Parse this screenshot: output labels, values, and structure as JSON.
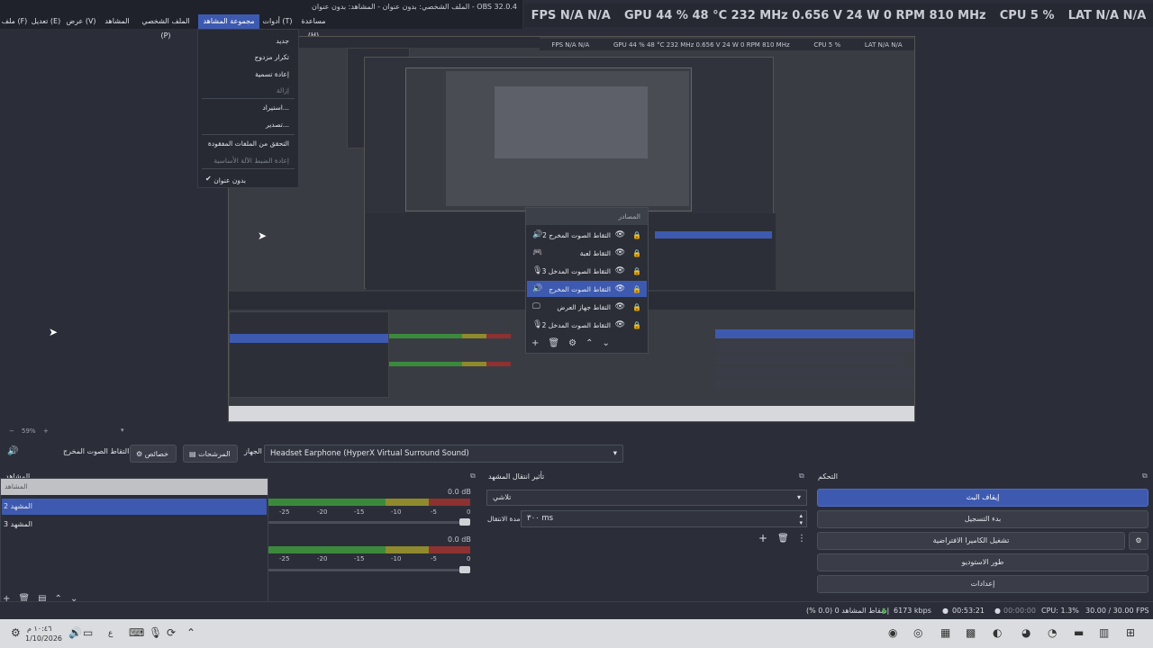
{
  "window": {
    "title": "OBS 32.0.4 - الملف الشخصي: بدون عنوان - المشاهد: بدون عنوان"
  },
  "menu": [
    {
      "label": "ملف (F)"
    },
    {
      "label": "تعديل (E)"
    },
    {
      "label": "عرض (V)"
    },
    {
      "label": "المشاهد"
    },
    {
      "label": "الملف الشخصي (P)"
    },
    {
      "label": "مجموعة المشاهد (S)"
    },
    {
      "label": "أدوات (T)"
    },
    {
      "label": "مساعدة (H)"
    }
  ],
  "stats_overlay": {
    "fps": "FPS  N/A  N/A",
    "gpu": "GPU  44 %  48 °C  232 MHz  0.656 V  24 W  0 RPM  810 MHz",
    "cpu": "CPU  5 %",
    "lat": "LAT  N/A  N/A"
  },
  "dropdown": {
    "items": [
      {
        "label": "جديد",
        "disabled": false
      },
      {
        "label": "تكرار مزدوج",
        "disabled": false
      },
      {
        "label": "إعادة تسمية",
        "disabled": false
      },
      {
        "label": "إزالة",
        "disabled": true
      },
      {
        "label": "استيراد...",
        "disabled": false
      },
      {
        "label": "تصدير...",
        "disabled": false
      },
      {
        "label": "التحقق من الملفات المفقودة",
        "disabled": false
      },
      {
        "label": "إعادة الضبط الآلة الأساسية",
        "disabled": true
      },
      {
        "label": "بدون عنوان",
        "disabled": false,
        "checked": true
      }
    ]
  },
  "sources": {
    "header": "المصادر",
    "items": [
      {
        "label": "التقاط الصوت المخرج 2",
        "icon": "speaker-icon"
      },
      {
        "label": "التقاط لعبة",
        "icon": "gamepad-icon"
      },
      {
        "label": "التقاط الصوت المدخل 3",
        "icon": "microphone-icon"
      },
      {
        "label": "التقاط الصوت المخرج",
        "icon": "speaker-icon",
        "selected": true
      },
      {
        "label": "التقاط جهاز العرض",
        "icon": "monitor-icon"
      },
      {
        "label": "التقاط الصوت المدخل 2",
        "icon": "microphone-icon"
      }
    ]
  },
  "zoom": {
    "value": "59%"
  },
  "device_bar": {
    "source_label": "التقاط الصوت المخرج",
    "properties": "خصائص",
    "filters": "المرشحات",
    "device_label": "الجهاز",
    "device_value": "Headset Earphone (HyperX Virtual Surround Sound)"
  },
  "docks": {
    "scenes_title": "المشاهد",
    "transitions_title": "تأثير انتقال المشهد",
    "controls_title": "التحكم"
  },
  "scenes": {
    "header": "المشاهد",
    "items": [
      {
        "label": "المشهد 2",
        "selected": true
      },
      {
        "label": "المشهد 3",
        "selected": false
      }
    ]
  },
  "mixer": {
    "db1": "0.0 dB",
    "db2": "0.0 dB",
    "scale": [
      "-25",
      "-20",
      "-15",
      "-10",
      "-5",
      "0"
    ]
  },
  "transitions": {
    "type": "تلاشي",
    "duration_label": "مدة الانتقال",
    "duration_value": "٣٠٠ ms"
  },
  "controls": {
    "stop_stream": "إيقاف البث",
    "start_record": "بدء التسجيل",
    "virtual_cam": "تشغيل الكاميرا الافتراضية",
    "studio_mode": "طور الاستوديو",
    "settings": "إعدادات"
  },
  "status": {
    "dropped": "إسقاط المشاهد 0 (0.0 %)",
    "bitrate": "6173 kbps",
    "stream_time": "00:53:21",
    "rec_time": "00:00:00",
    "cpu": "CPU: 1.3%",
    "fps": "30.00 / 30.00 FPS"
  },
  "taskbar": {
    "time": "١٠:٤٦ م",
    "date": "1/10/2026",
    "lang": "ع"
  },
  "colors": {
    "accent": "#3d5ab0",
    "bg": "#2b2e38"
  }
}
